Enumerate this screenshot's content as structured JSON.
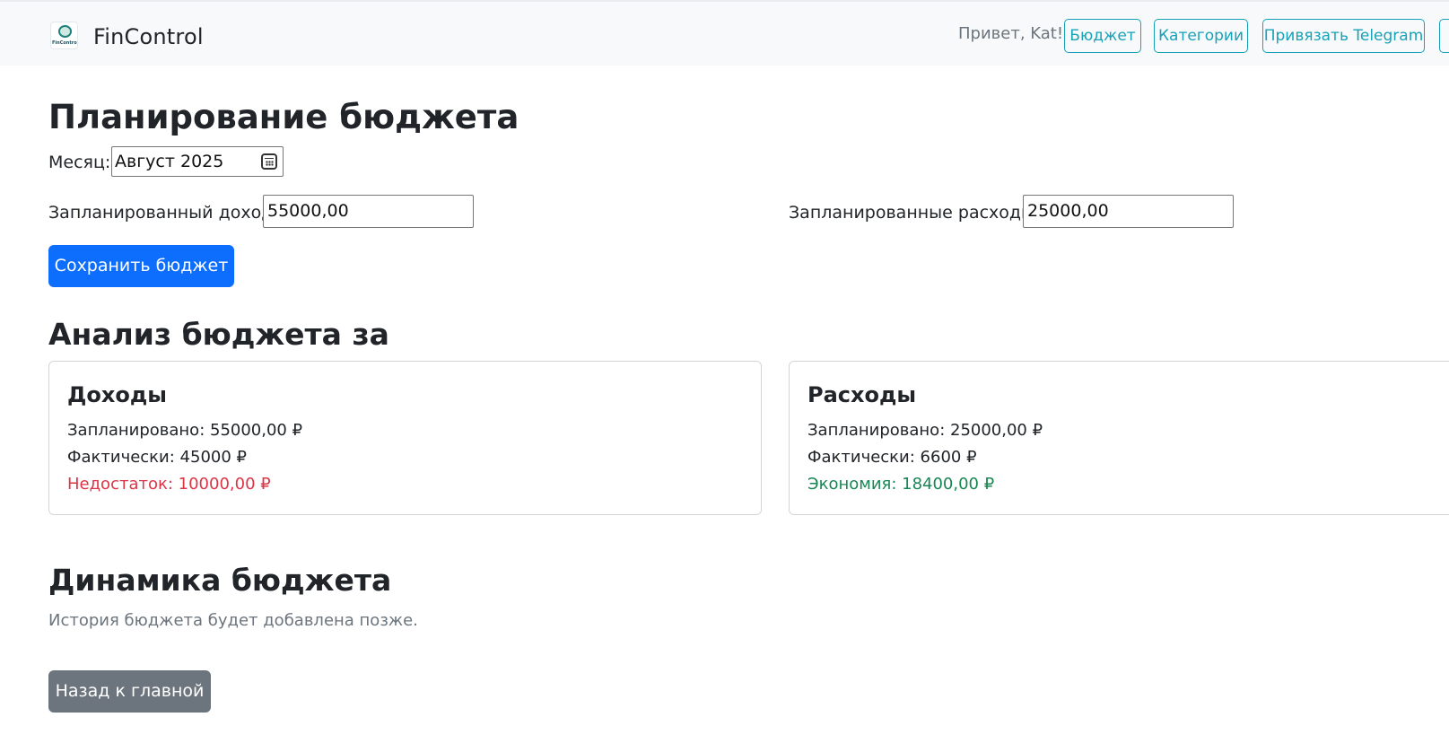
{
  "navbar": {
    "brand": "FinControl",
    "logo_text": "FinControl",
    "greeting": "Привет, Kat!",
    "links": [
      "Бюджет",
      "Категории",
      "Привязать Telegram",
      ""
    ],
    "accent_color": "#17a2b8"
  },
  "page": {
    "title": "Планирование бюджета"
  },
  "form": {
    "month_label": "Месяц:",
    "month_value": "Август 2025",
    "income_label": "Запланированный доход:",
    "income_value": "55000,00",
    "expense_label": "Запланированные расходы:",
    "expense_value": "25000,00",
    "save_label": "Сохранить бюджет"
  },
  "analysis": {
    "title": "Анализ бюджета за",
    "income": {
      "title": "Доходы",
      "planned": "Запланировано: 55000,00 ₽",
      "actual": "Фактически: 45000 ₽",
      "diff": "Недостаток: 10000,00 ₽",
      "diff_color": "#dc3545"
    },
    "expense": {
      "title": "Расходы",
      "planned": "Запланировано: 25000,00 ₽",
      "actual": "Фактически: 6600 ₽",
      "diff": "Экономия: 18400,00 ₽",
      "diff_color": "#198754"
    }
  },
  "dynamics": {
    "title": "Динамика бюджета",
    "note": "История бюджета будет добавлена позже."
  },
  "back_label": "Назад к главной",
  "icons": {
    "calendar": "calendar-icon",
    "logo": "fincontrol-logo"
  }
}
